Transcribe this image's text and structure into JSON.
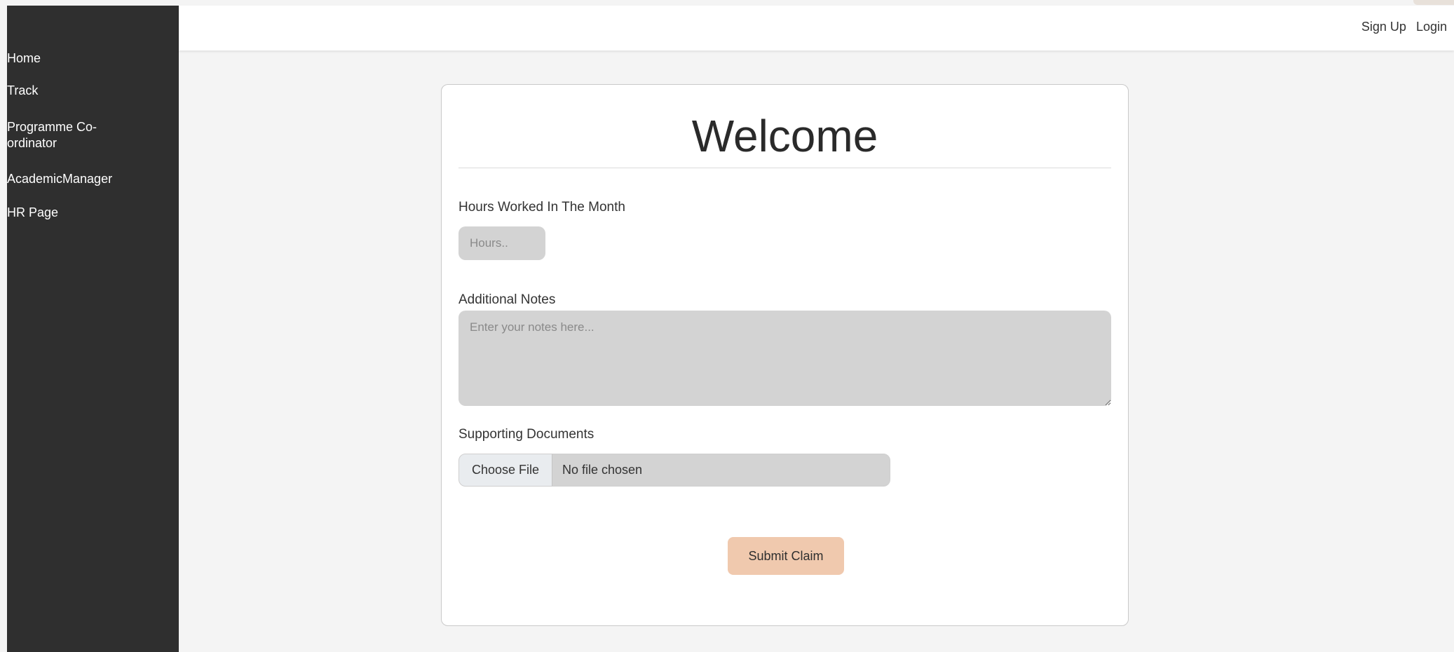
{
  "sidebar": {
    "items": [
      {
        "label": "Home"
      },
      {
        "label": "Track"
      },
      {
        "label": "Programme Co-ordinator"
      },
      {
        "label": "AcademicManager"
      },
      {
        "label": "HR Page"
      }
    ]
  },
  "header": {
    "sign_up": "Sign Up",
    "login": "Login"
  },
  "form": {
    "title": "Welcome",
    "hours_label": "Hours Worked In The Month",
    "hours_placeholder": "Hours..",
    "notes_label": "Additional Notes",
    "notes_placeholder": "Enter your notes here...",
    "docs_label": "Supporting Documents",
    "choose_file": "Choose File",
    "no_file": "No file chosen",
    "submit": "Submit Claim"
  },
  "colors": {
    "sidebar_bg": "#2f2f2f",
    "page_bg": "#f4f4f4",
    "submit_bg": "#f0c9ae",
    "input_bg": "#d3d3d3"
  }
}
